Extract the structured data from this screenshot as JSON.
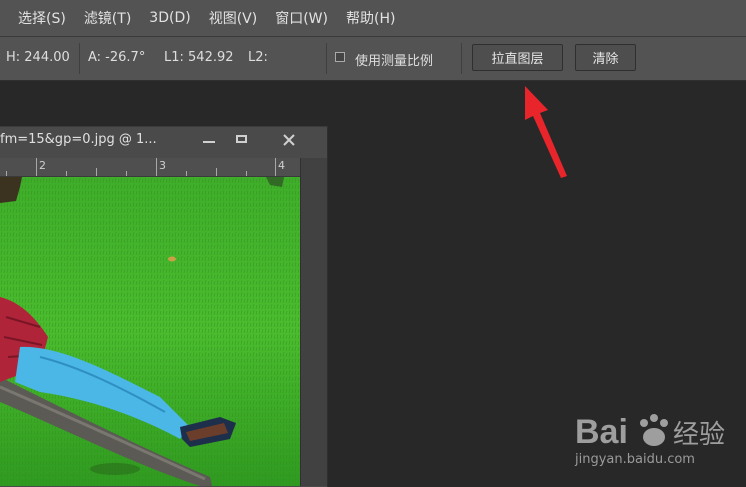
{
  "menu": [
    "选择(S)",
    "滤镜(T)",
    "3D(D)",
    "视图(V)",
    "窗口(W)",
    "帮助(H)"
  ],
  "options": {
    "h_value": "H: 244.00",
    "angle_value": "A: -26.7°",
    "l1_value": "L1: 542.92",
    "l2_value": "L2:",
    "use_measure_scale_label": "使用测量比例",
    "straighten_layer_label": "拉直图层",
    "clear_label": "清除"
  },
  "document": {
    "title": "fm=15&gp=0.jpg @ 1...",
    "ruler_marks": [
      "2",
      "3",
      "4"
    ]
  },
  "watermark": {
    "brand_prefix": "Bai",
    "brand_suffix": "经验",
    "site": "jingyan.baidu.com"
  },
  "colors": {
    "annotation_arrow": "#e8252b",
    "menubar": "#535353",
    "workspace": "#282828"
  },
  "icons": [
    "minimize-icon",
    "restore-icon",
    "close-icon",
    "red-pointer-arrow",
    "baidu-paw-icon"
  ]
}
